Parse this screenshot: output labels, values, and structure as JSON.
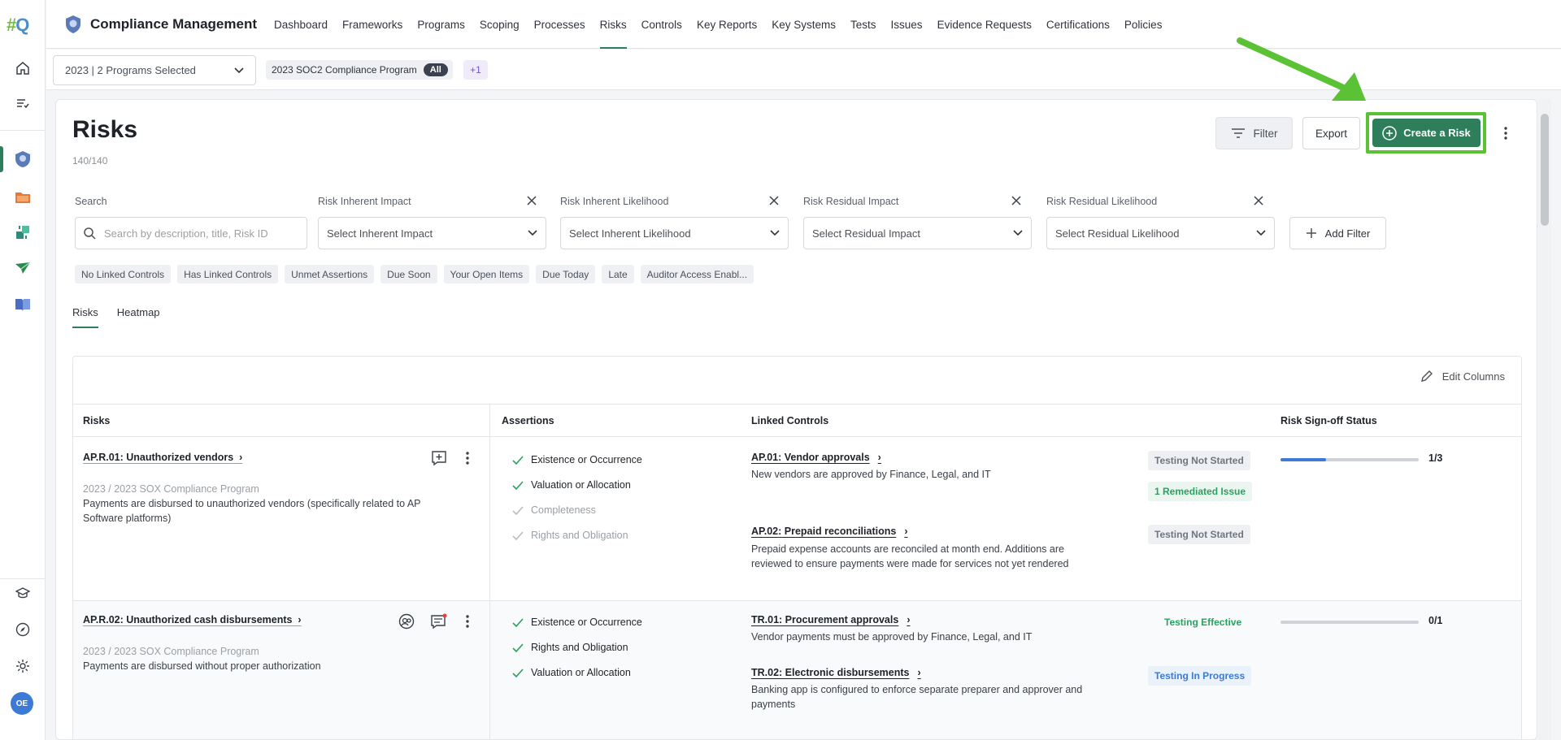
{
  "app": {
    "logo_hash": "#",
    "logo_q": "Q",
    "title": "Compliance Management",
    "user_initials": "OE"
  },
  "nav": {
    "items": [
      "Dashboard",
      "Frameworks",
      "Programs",
      "Scoping",
      "Processes",
      "Risks",
      "Controls",
      "Key Reports",
      "Key Systems",
      "Tests",
      "Issues",
      "Evidence Requests",
      "Certifications",
      "Policies"
    ],
    "active": "Risks"
  },
  "program_bar": {
    "selector_value": "2023 | 2 Programs Selected",
    "chip_label": "2023 SOC2 Compliance Program",
    "chip_badge": "All",
    "more": "+1"
  },
  "page": {
    "title": "Risks",
    "count": "140/140",
    "filter_label": "Filter",
    "export_label": "Export",
    "create_label": "Create a Risk"
  },
  "filters": {
    "search_label": "Search",
    "search_placeholder": "Search by description, title, Risk ID",
    "inherent_impact_label": "Risk Inherent Impact",
    "inherent_impact_placeholder": "Select Inherent Impact",
    "inherent_likelihood_label": "Risk Inherent Likelihood",
    "inherent_likelihood_placeholder": "Select Inherent Likelihood",
    "residual_impact_label": "Risk Residual Impact",
    "residual_impact_placeholder": "Select Residual Impact",
    "residual_likelihood_label": "Risk Residual Likelihood",
    "residual_likelihood_placeholder": "Select Residual Likelihood",
    "add_filter_label": "Add Filter"
  },
  "quick_filters": [
    "No Linked Controls",
    "Has Linked Controls",
    "Unmet Assertions",
    "Due Soon",
    "Your Open Items",
    "Due Today",
    "Late",
    "Auditor Access Enabl..."
  ],
  "tabs": [
    "Risks",
    "Heatmap"
  ],
  "table": {
    "edit_columns_label": "Edit Columns",
    "headers": [
      "Risks",
      "Assertions",
      "Linked Controls",
      "Risk Sign-off Status"
    ],
    "rows": [
      {
        "title": "AP.R.01: Unauthorized vendors",
        "program": "2023 / 2023 SOX Compliance Program",
        "description": "Payments are disbursed to unauthorized vendors (specifically related to AP Software platforms)",
        "assertions": [
          {
            "label": "Existence or Occurrence",
            "met": true
          },
          {
            "label": "Valuation or Allocation",
            "met": true
          },
          {
            "label": "Completeness",
            "met": false
          },
          {
            "label": "Rights and Obligation",
            "met": false
          }
        ],
        "controls": [
          {
            "title": "AP.01: Vendor approvals",
            "description": "New vendors are approved by Finance, Legal, and IT",
            "status": "Testing Not Started",
            "issue": "1 Remediated Issue"
          },
          {
            "title": "AP.02: Prepaid reconciliations",
            "description": "Prepaid expense accounts are reconciled at month end. Additions are reviewed to ensure payments were made for services not yet rendered",
            "status": "Testing Not Started"
          }
        ],
        "signoff": "1/3",
        "signoff_progress": 0.33
      },
      {
        "title": "AP.R.02: Unauthorized cash disbursements",
        "program": "2023 / 2023 SOX Compliance Program",
        "description": "Payments are disbursed without proper authorization",
        "assertions": [
          {
            "label": "Existence or Occurrence",
            "met": true
          },
          {
            "label": "Rights and Obligation",
            "met": true
          },
          {
            "label": "Valuation or Allocation",
            "met": true
          }
        ],
        "controls": [
          {
            "title": "TR.01: Procurement approvals",
            "description": "Vendor payments must be approved by Finance, Legal, and IT",
            "status": "Testing Effective"
          },
          {
            "title": "TR.02: Electronic disbursements",
            "description": "Banking app is configured to enforce separate preparer and approver and payments",
            "status": "Testing In Progress"
          }
        ],
        "signoff": "0/1",
        "signoff_progress": 0
      }
    ]
  },
  "colors": {
    "brand_green": "#2e7d5b",
    "annotation_green": "#5bc236",
    "link_blue": "#3d7ad6"
  }
}
